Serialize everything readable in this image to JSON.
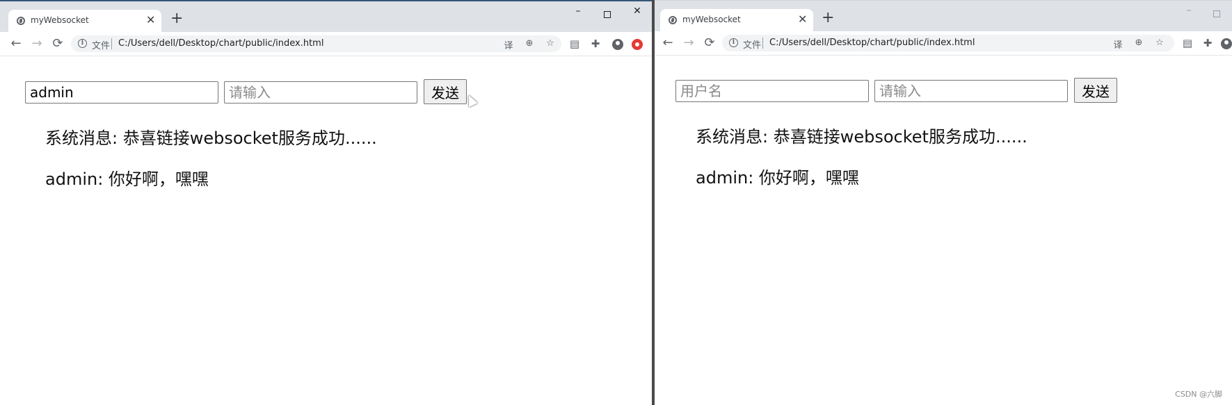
{
  "left_window": {
    "tab_title": "myWebsocket",
    "tab_close": "✕",
    "new_tab": "+",
    "win_min": "–",
    "win_close": "✕",
    "nav": {
      "back": "←",
      "forward": "→",
      "reload": "⟳"
    },
    "address_label": "文件",
    "url": "C:/Users/dell/Desktop/chart/public/index.html",
    "username_value": "admin",
    "message_placeholder": "请输入",
    "send_label": "发送",
    "messages": [
      "系统消息: 恭喜链接websocket服务成功......",
      "admin: 你好啊，嘿嘿"
    ]
  },
  "right_window": {
    "tab_title": "myWebsocket",
    "tab_close": "✕",
    "new_tab": "+",
    "win_min": "–",
    "nav": {
      "back": "←",
      "forward": "→",
      "reload": "⟳"
    },
    "address_label": "文件",
    "url": "C:/Users/dell/Desktop/chart/public/index.html",
    "username_placeholder": "用户名",
    "message_placeholder": "请输入",
    "send_label": "发送",
    "messages": [
      "系统消息: 恭喜链接websocket服务成功......",
      "admin: 你好啊，嘿嘿"
    ]
  },
  "icons": {
    "translate": "译",
    "zoom": "⊕",
    "star": "☆",
    "extension": "✚"
  },
  "watermark": "CSDN @六脚"
}
